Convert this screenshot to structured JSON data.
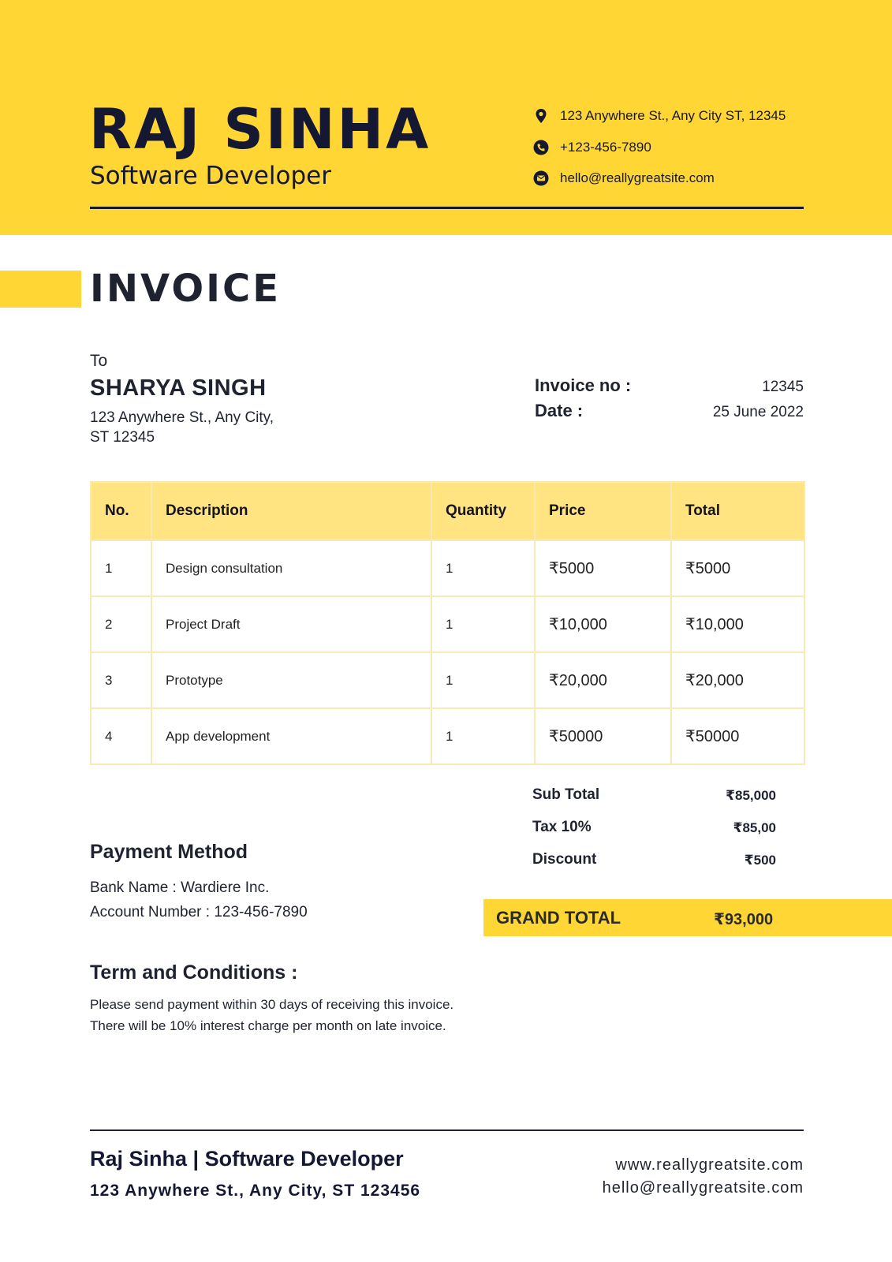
{
  "header": {
    "name": "RAJ SINHA",
    "role": "Software Developer",
    "address": "123 Anywhere St., Any City ST, 12345",
    "phone": "+123-456-7890",
    "email": "hello@reallygreatsite.com"
  },
  "invoice": {
    "title": "INVOICE",
    "to_label": "To",
    "client_name": "SHARYA SINGH",
    "client_address": "123 Anywhere St., Any City, ST 12345",
    "number_label": "Invoice no :",
    "number": "12345",
    "date_label": "Date :",
    "date": "25 June 2022"
  },
  "table": {
    "headers": [
      "No.",
      "Description",
      "Quantity",
      "Price",
      "Total"
    ],
    "rows": [
      {
        "no": "1",
        "description": "Design consultation",
        "quantity": "1",
        "price": "₹5000",
        "total": "₹5000"
      },
      {
        "no": "2",
        "description": "Project Draft",
        "quantity": "1",
        "price": "₹10,000",
        "total": "₹10,000"
      },
      {
        "no": "3",
        "description": "Prototype",
        "quantity": "1",
        "price": "₹20,000",
        "total": "₹20,000"
      },
      {
        "no": "4",
        "description": "App development",
        "quantity": "1",
        "price": "₹50000",
        "total": "₹50000"
      }
    ]
  },
  "summary": {
    "subtotal_label": "Sub Total",
    "subtotal": "₹85,000",
    "tax_label": "Tax 10%",
    "tax": "₹85,00",
    "discount_label": "Discount",
    "discount": "₹500",
    "grand_total_label": "GRAND TOTAL",
    "grand_total": "₹93,000"
  },
  "payment": {
    "title": "Payment Method",
    "bank": "Bank Name : Wardiere Inc.",
    "account": "Account Number : 123-456-7890"
  },
  "terms": {
    "title": "Term and Conditions :",
    "text": "Please send payment within 30 days of receiving this invoice. There will be 10% interest charge per month on late invoice."
  },
  "footer": {
    "name_role": "Raj Sinha | Software Developer",
    "address": "123 Anywhere St., Any City, ST 123456",
    "website": "www.reallygreatsite.com",
    "email": "hello@reallygreatsite.com"
  },
  "colors": {
    "accent": "#ffd633",
    "table_header": "#ffe481",
    "dark": "#141833"
  }
}
